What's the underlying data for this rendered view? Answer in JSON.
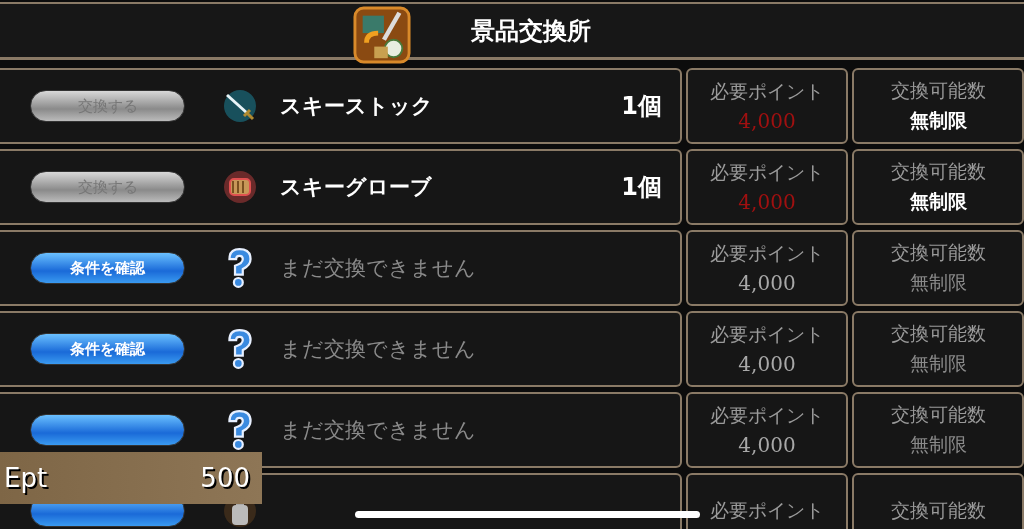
{
  "header": {
    "title": "景品交換所"
  },
  "rows": [
    {
      "button": {
        "label": "交換する",
        "kind": "grey"
      },
      "kind": "sword",
      "name": "スキーストック",
      "count": "1個",
      "locked": false,
      "points_label": "必要ポイント",
      "points": "4,000",
      "insufficient": true,
      "limit_label": "交換可能数",
      "limit": "無制限"
    },
    {
      "button": {
        "label": "交換する",
        "kind": "grey"
      },
      "kind": "glove",
      "name": "スキーグローブ",
      "count": "1個",
      "locked": false,
      "points_label": "必要ポイント",
      "points": "4,000",
      "insufficient": true,
      "limit_label": "交換可能数",
      "limit": "無制限"
    },
    {
      "button": {
        "label": "条件を確認",
        "kind": "blue"
      },
      "kind": "question",
      "name": "まだ交換できません",
      "locked": true,
      "points_label": "必要ポイント",
      "points": "4,000",
      "insufficient": false,
      "limit_label": "交換可能数",
      "limit": "無制限"
    },
    {
      "button": {
        "label": "条件を確認",
        "kind": "blue"
      },
      "kind": "question",
      "name": "まだ交換できません",
      "locked": true,
      "points_label": "必要ポイント",
      "points": "4,000",
      "insufficient": false,
      "limit_label": "交換可能数",
      "limit": "無制限"
    },
    {
      "button": {
        "kind": "blue"
      },
      "kind": "question",
      "name": "まだ交換できません",
      "locked": true,
      "points_label": "必要ポイント",
      "points": "4,000",
      "insufficient": false,
      "limit_label": "交換可能数",
      "limit": "無制限"
    },
    {
      "button": {
        "kind": "blue"
      },
      "kind": "bottle",
      "points_label": "必要ポイント",
      "limit_label": "交換可能数"
    }
  ],
  "points_panel": {
    "label": "Ept",
    "value": "500"
  }
}
